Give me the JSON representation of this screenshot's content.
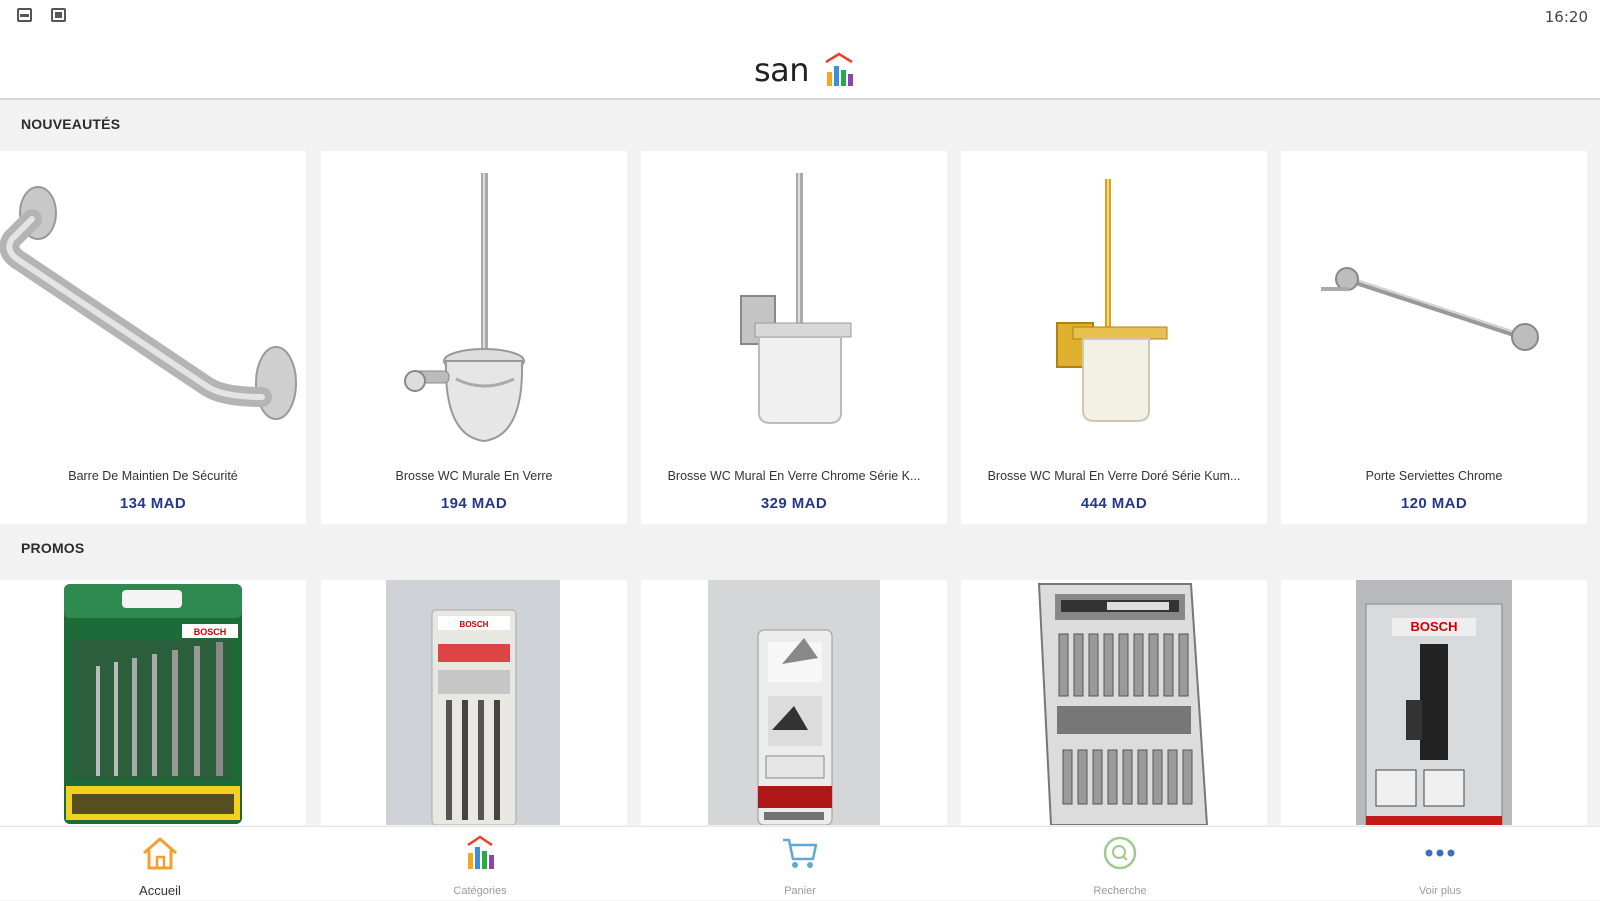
{
  "status_bar": {
    "time": "16:20"
  },
  "header": {
    "logo_text": "san",
    "logo_colors": [
      "#e8421f",
      "#f5a623",
      "#3a8fd6",
      "#2aa84a",
      "#8e44ad"
    ]
  },
  "sections": {
    "new": {
      "title": "NOUVEAUTÉS",
      "products": [
        {
          "name": "Barre De Maintien De Sécurité",
          "price": "134 MAD",
          "image": "grab-bar"
        },
        {
          "name": "Brosse WC Murale En Verre",
          "price": "194 MAD",
          "image": "toilet-brush-chrome"
        },
        {
          "name": "Brosse WC Mural En Verre Chrome Série K...",
          "price": "329 MAD",
          "image": "toilet-brush-square"
        },
        {
          "name": "Brosse WC Mural En Verre Doré Série Kum...",
          "price": "444 MAD",
          "image": "toilet-brush-gold"
        },
        {
          "name": "Porte Serviettes Chrome",
          "price": "120 MAD",
          "image": "towel-bar"
        }
      ]
    },
    "promos": {
      "title": "PROMOS",
      "products": [
        {
          "image": "drill-bit-set",
          "brand": "BOSCH"
        },
        {
          "image": "jigsaw-blades",
          "brand": "BOSCH"
        },
        {
          "image": "router-bit",
          "brand": ""
        },
        {
          "image": "screwdriver-bit-set",
          "brand": ""
        },
        {
          "image": "tool-attachment",
          "brand": "BOSCH"
        }
      ]
    }
  },
  "bottom_nav": [
    {
      "label": "Accueil",
      "icon": "home-icon",
      "active": true
    },
    {
      "label": "Catégories",
      "icon": "categories-icon",
      "active": false
    },
    {
      "label": "Panier",
      "icon": "cart-icon",
      "active": false
    },
    {
      "label": "Recherche",
      "icon": "search-icon",
      "active": false
    },
    {
      "label": "Voir plus",
      "icon": "more-icon",
      "active": false
    }
  ]
}
